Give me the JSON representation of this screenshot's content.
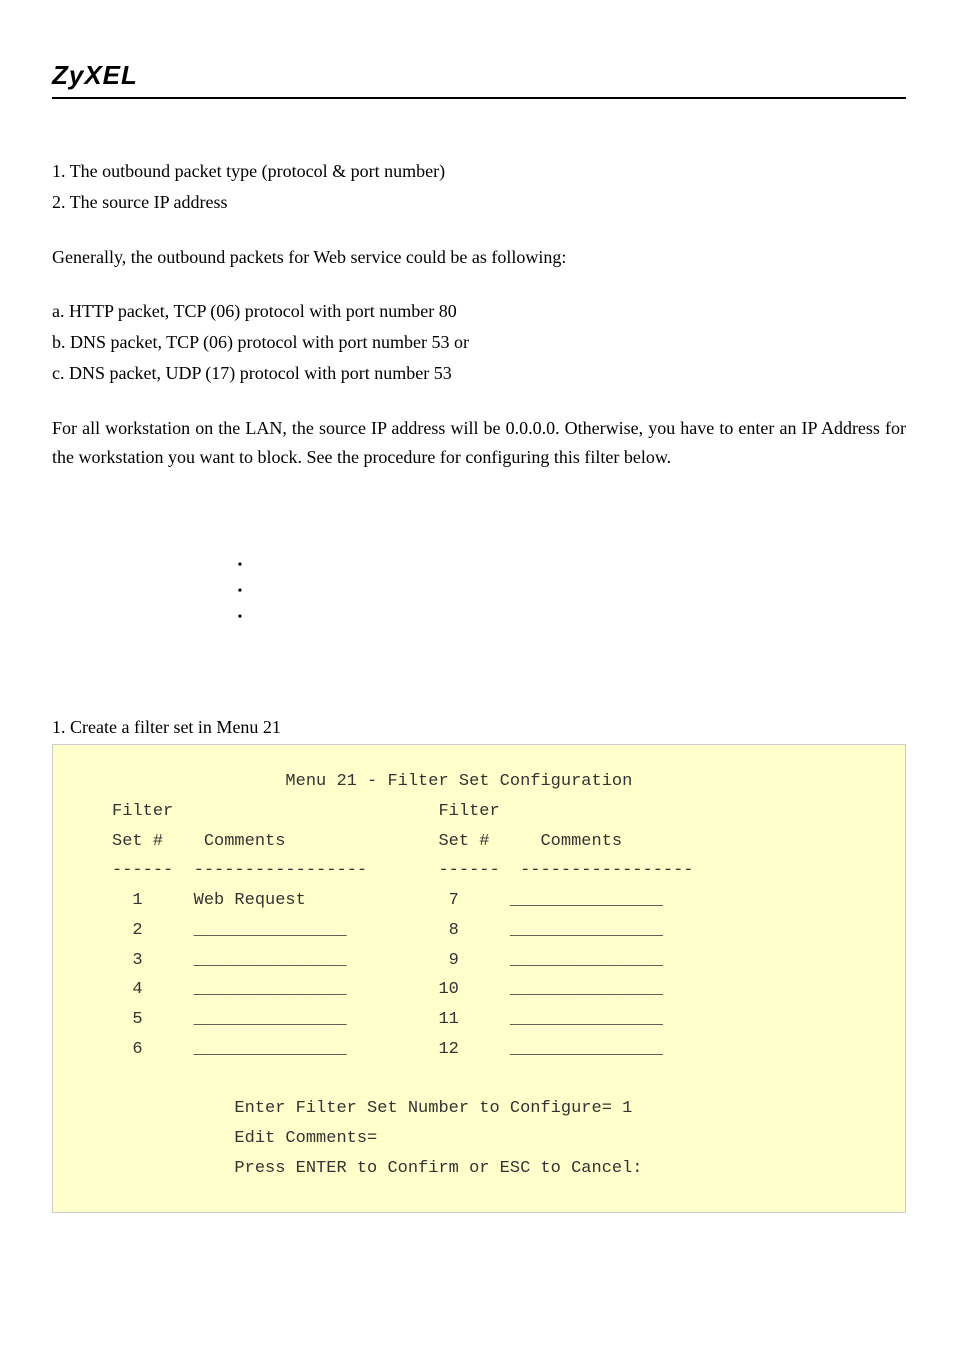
{
  "logo": "ZyXEL",
  "intro_list": [
    "1. The outbound packet type (protocol & port number)",
    "2. The source IP address"
  ],
  "intro_para": "Generally, the outbound packets for Web service could be as following:",
  "packet_list": [
    "a. HTTP packet, TCP (06) protocol with port number 80",
    "b. DNS packet, TCP (06) protocol with port number 53 or",
    "c. DNS packet, UDP (17) protocol with port number 53"
  ],
  "main_para": "For all workstation on the LAN, the source IP address will be 0.0.0.0. Otherwise, you have to enter an IP Address for the workstation you want to block. See the procedure for configuring this filter below.",
  "step_heading": "1. Create a filter set in Menu 21",
  "terminal": {
    "title": "Menu 21 - Filter Set Configuration",
    "col_header_l1": "Filter",
    "col_set": "Set #",
    "col_comments": "Comments",
    "rows_left": [
      {
        "n": "1",
        "c": "Web Request"
      },
      {
        "n": "2",
        "c": "_______________"
      },
      {
        "n": "3",
        "c": "_______________"
      },
      {
        "n": "4",
        "c": "_______________"
      },
      {
        "n": "5",
        "c": "_______________"
      },
      {
        "n": "6",
        "c": "_______________"
      }
    ],
    "rows_right": [
      {
        "n": "7",
        "c": "_______________"
      },
      {
        "n": "8",
        "c": "_______________"
      },
      {
        "n": "9",
        "c": "_______________"
      },
      {
        "n": "10",
        "c": "_______________"
      },
      {
        "n": "11",
        "c": "_______________"
      },
      {
        "n": "12",
        "c": "_______________"
      }
    ],
    "footer1": "Enter Filter Set Number to Configure= 1",
    "footer2": "Edit Comments=",
    "footer3": "Press ENTER to Confirm or ESC to Cancel:"
  }
}
